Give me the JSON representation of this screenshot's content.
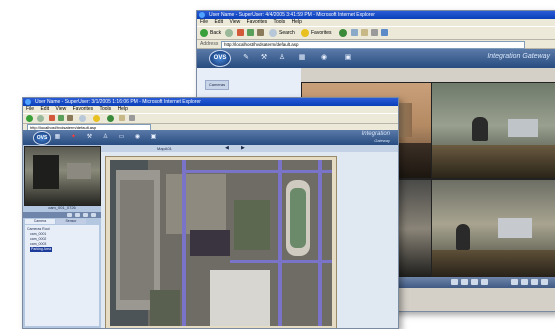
{
  "back_window": {
    "title": "User Name - SuperUser: 4/4/2005 3:41:59 PM - Microsoft Internet Explorer",
    "menu": [
      "File",
      "Edit",
      "View",
      "Favorites",
      "Tools",
      "Help"
    ],
    "toolbar": {
      "back_label": "Back",
      "search_label": "Search",
      "favorites_label": "Favorites"
    },
    "address": {
      "label": "Address",
      "url": "http://localhost/hvdsaterm/default.asp"
    },
    "logo": "OVS",
    "brand_text": "Integration Gateway",
    "sidebar_tab": "Cameras",
    "nav_icons": [
      "pin-icon",
      "wrench-icon",
      "person-icon",
      "grid-icon",
      "eye-icon",
      "camera-icon"
    ]
  },
  "front_window": {
    "title": "User Name - SuperUser: 3/1/2005 1:16:06 PM - Microsoft Internet Explorer",
    "menu": [
      "File",
      "Edit",
      "View",
      "Favorites",
      "Tools",
      "Help"
    ],
    "address": {
      "url": "http://localhost/hvdsaterm/default.asp"
    },
    "logo": "OVS",
    "brand_text": "Integration",
    "brand_sub": "Gateway",
    "map_title": "MapA01",
    "camera_caption": "cam_001_0726",
    "tree_tabs": [
      "Camera",
      "Sensor"
    ],
    "tree_items": [
      {
        "label": "Cameras Root",
        "selected": false
      },
      {
        "label": "cam_0001",
        "selected": false
      },
      {
        "label": "cam_0002",
        "selected": false
      },
      {
        "label": "cam_0003",
        "selected": false
      },
      {
        "label": "Parking Area",
        "selected": true
      }
    ]
  },
  "colors": {
    "title_bar": "#0a3fb8",
    "app_bar": "#284c80",
    "tree_selection": "#1c3c9c",
    "chrome": "#ece9d8"
  }
}
